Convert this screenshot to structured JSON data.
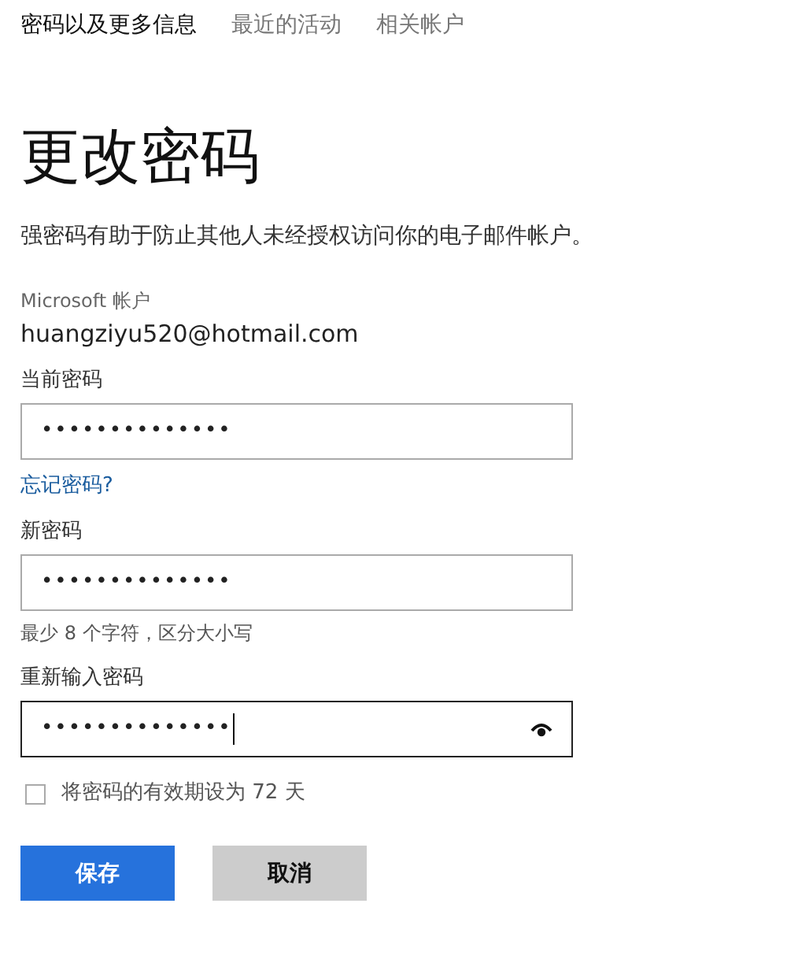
{
  "tabs": [
    {
      "label": "密码以及更多信息",
      "selected": true
    },
    {
      "label": "最近的活动",
      "selected": false
    },
    {
      "label": "相关帐户",
      "selected": false
    }
  ],
  "title": "更改密码",
  "description": "强密码有助于防止其他人未经授权访问你的电子邮件帐户。",
  "account": {
    "label": "Microsoft 帐户",
    "email": "huangziyu520@hotmail.com"
  },
  "fields": [
    {
      "label": "当前密码",
      "value": "••••••••••••••",
      "focused": false,
      "link": "忘记密码?"
    },
    {
      "label": "新密码",
      "value": "••••••••••••••",
      "focused": false,
      "hint": "最少 8 个字符，区分大小写"
    },
    {
      "label": "重新输入密码",
      "value": "••••••••••••••",
      "focused": true
    }
  ],
  "expiry": {
    "label": "将密码的有效期设为 72 天",
    "checked": false
  },
  "buttons": [
    {
      "label": "保存",
      "kind": "primary"
    },
    {
      "label": "取消",
      "kind": "secondary"
    }
  ]
}
